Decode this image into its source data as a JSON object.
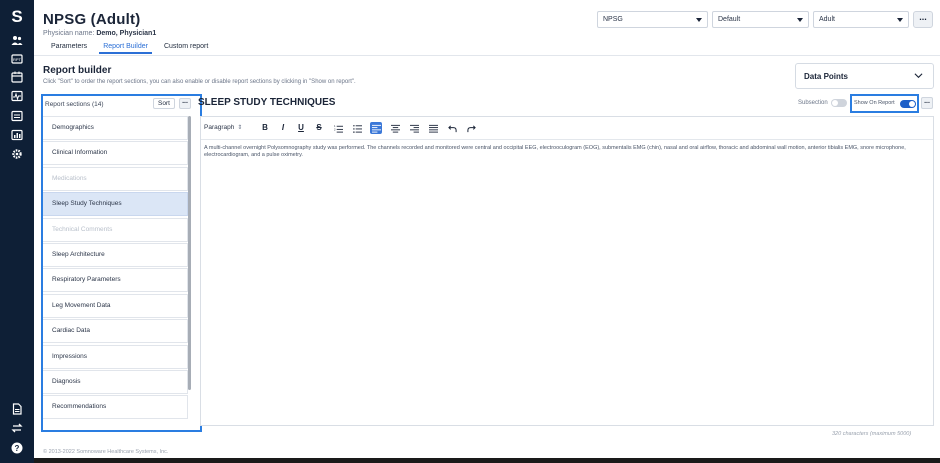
{
  "rail": {
    "logo": "S",
    "top_icons": [
      "people-icon",
      "report-icon",
      "calendar-icon",
      "waveform-icon",
      "document-icon",
      "chart-icon",
      "gear-icon"
    ],
    "bottom_icons": [
      "file-icon",
      "swap-icon",
      "help-icon"
    ]
  },
  "header": {
    "title": "NPSG (Adult)",
    "physician_label": "Physician name:",
    "physician_name": "Demo, Physician1",
    "tabs": [
      {
        "label": "Parameters",
        "active": false
      },
      {
        "label": "Report Builder",
        "active": true
      },
      {
        "label": "Custom report",
        "active": false
      }
    ],
    "selects": [
      {
        "value": "NPSG"
      },
      {
        "value": "Default"
      },
      {
        "value": "Adult"
      }
    ],
    "more_label": "..."
  },
  "builder": {
    "title": "Report builder",
    "hint": "Click \"Sort\" to order the report sections, you can also enable or disable report sections by clicking in \"Show on report\".",
    "data_points_label": "Data Points"
  },
  "sections": {
    "count_label": "Report sections (14)",
    "sort_label": "Sort",
    "more_label": "...",
    "items": [
      {
        "label": "Demographics",
        "state": "normal"
      },
      {
        "label": "Clinical Information",
        "state": "normal"
      },
      {
        "label": "Medications",
        "state": "disabled"
      },
      {
        "label": "Sleep Study Techniques",
        "state": "active"
      },
      {
        "label": "Technical Comments",
        "state": "disabled"
      },
      {
        "label": "Sleep Architecture",
        "state": "normal"
      },
      {
        "label": "Respiratory Parameters",
        "state": "normal"
      },
      {
        "label": "Leg Movement Data",
        "state": "normal"
      },
      {
        "label": "Cardiac Data",
        "state": "normal"
      },
      {
        "label": "Impressions",
        "state": "normal"
      },
      {
        "label": "Diagnosis",
        "state": "normal"
      },
      {
        "label": "Recommendations",
        "state": "normal"
      }
    ]
  },
  "editor": {
    "section_title": "SLEEP STUDY TECHNIQUES",
    "subsection_label": "Subsection",
    "subsection_on": false,
    "show_on_report_label": "Show On Report",
    "show_on_report_on": true,
    "more_label": "...",
    "paragraph_label": "Paragraph",
    "paragraph_arrow": "⇕",
    "toolbar": {
      "bold": "B",
      "italic": "I",
      "underline": "U",
      "strike": "S"
    },
    "content": "A multi-channel overnight Polysomnography study was performed. The channels recorded and monitored were central and occipital EEG, electrooculogram (EOG), submentalis EMG (chin), nasal and oral airflow, thoracic and abdominal wall motion, anterior tibialis EMG, snore microphone, electrocardiogram, and a pulse oximetry.",
    "char_count": "320 characters (maximum 5000)"
  },
  "footer": {
    "copyright": "© 2013-2022 Somnoware Healthcare Systems, Inc."
  },
  "colors": {
    "rail": "#0e1f36",
    "accent": "#2b6fd6",
    "highlight_border": "#2a7de1",
    "toggle_on": "#1e5fc7"
  }
}
